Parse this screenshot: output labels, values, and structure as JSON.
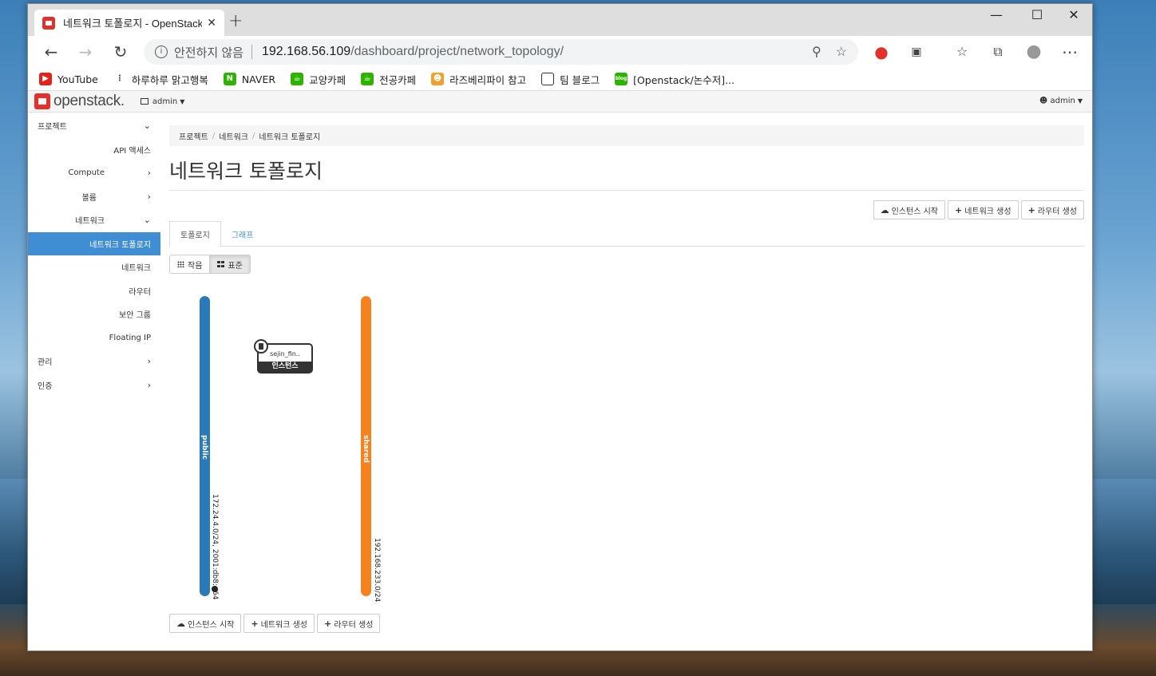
{
  "browser": {
    "tab_title": "네트워크 토폴로지 - OpenStack",
    "tab_close": "✕",
    "new_tab": "+",
    "window_controls": {
      "minimize": "—",
      "maximize": "☐",
      "close": "✕"
    },
    "address": {
      "security_label": "안전하지 않음",
      "host": "192.168.56.109",
      "path": "/dashboard/project/network_topology/"
    },
    "bookmarks": [
      {
        "label": "YouTube",
        "icon": "youtube-icon",
        "color": "#e62117"
      },
      {
        "label": "하루하루 맑고행복",
        "icon": "dots-icon",
        "color": "#333333"
      },
      {
        "label": "NAVER",
        "icon": "naver-icon",
        "color": "#2db400"
      },
      {
        "label": "교양카페",
        "icon": "cafe-icon",
        "color": "#2db400"
      },
      {
        "label": "전공카페",
        "icon": "cafe-icon",
        "color": "#2db400"
      },
      {
        "label": "라즈베리파이 참고",
        "icon": "avatar-icon",
        "color": "#f0a030"
      },
      {
        "label": "팀 블로그",
        "icon": "document-icon",
        "color": "#ffffff"
      },
      {
        "label": "[Openstack/논수저]...",
        "icon": "blog-icon",
        "color": "#2db400"
      }
    ]
  },
  "app": {
    "logo": "openstack.",
    "project_selector": "admin",
    "user_menu": "admin",
    "sidebar": [
      {
        "label": "프로젝트",
        "level": 0,
        "chevron": "down"
      },
      {
        "label": "API 액세스",
        "level": 2
      },
      {
        "label": "Compute",
        "level": 1,
        "chevron": "right"
      },
      {
        "label": "볼륨",
        "level": 1,
        "chevron": "right"
      },
      {
        "label": "네트워크",
        "level": 1,
        "chevron": "down"
      },
      {
        "label": "네트워크 토폴로지",
        "level": 2,
        "active": true
      },
      {
        "label": "네트워크",
        "level": 2
      },
      {
        "label": "라우터",
        "level": 2
      },
      {
        "label": "보안 그룹",
        "level": 2
      },
      {
        "label": "Floating IP",
        "level": 2
      },
      {
        "label": "관리",
        "level": 0,
        "chevron": "right"
      },
      {
        "label": "인증",
        "level": 0,
        "chevron": "right"
      }
    ],
    "breadcrumb": [
      "프로젝트",
      "네트워크",
      "네트워크 토폴로지"
    ],
    "page_title": "네트워크 토폴로지",
    "actions": {
      "launch_instance": "인스턴스 시작",
      "create_network": "네트워크 생성",
      "create_router": "라우터 생성"
    },
    "tabs": [
      {
        "label": "토폴로지",
        "active": true
      },
      {
        "label": "그래프",
        "active": false
      }
    ],
    "view_toggle": {
      "small": "작음",
      "normal": "표준",
      "selected": "normal"
    },
    "topology": {
      "networks": [
        {
          "name": "public",
          "cidr": "172.24.4.0/24, 2001:db8::/64",
          "color": "#2a7ab8",
          "external": true
        },
        {
          "name": "shared",
          "cidr": "192.168.233.0/24",
          "color": "#f5821f",
          "external": false
        }
      ],
      "instances": [
        {
          "name": "sejin_fin..",
          "type_label": "인스턴스"
        }
      ]
    }
  }
}
